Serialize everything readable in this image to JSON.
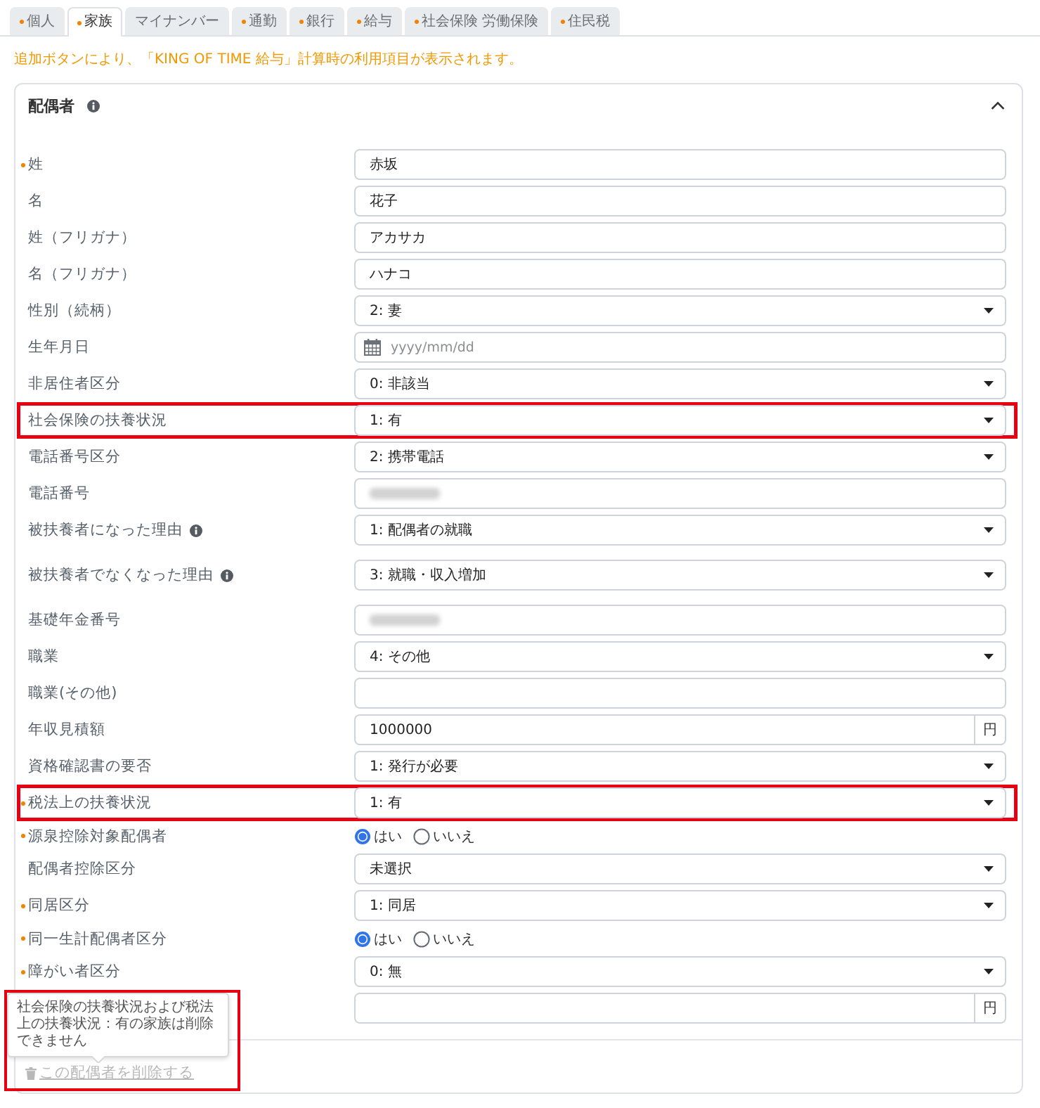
{
  "tabs": [
    {
      "label": "個人",
      "required": true,
      "selected": false
    },
    {
      "label": "家族",
      "required": true,
      "selected": true
    },
    {
      "label": "マイナンバー",
      "required": false,
      "selected": false
    },
    {
      "label": "通勤",
      "required": true,
      "selected": false
    },
    {
      "label": "銀行",
      "required": true,
      "selected": false
    },
    {
      "label": "給与",
      "required": true,
      "selected": false
    },
    {
      "label": "社会保険 労働保険",
      "required": true,
      "selected": false
    },
    {
      "label": "住民税",
      "required": true,
      "selected": false
    }
  ],
  "notice": "追加ボタンにより、「KING OF TIME 給与」計算時の利用項目が表示されます。",
  "card": {
    "title": "配偶者",
    "info": true,
    "expanded": true,
    "fields": [
      {
        "kind": "text",
        "label": "姓",
        "required": true,
        "info": false,
        "highlighted": false,
        "value": "赤坂"
      },
      {
        "kind": "text",
        "label": "名",
        "required": false,
        "info": false,
        "highlighted": false,
        "value": "花子"
      },
      {
        "kind": "text",
        "label": "姓（フリガナ）",
        "required": false,
        "info": false,
        "highlighted": false,
        "value": "アカサカ"
      },
      {
        "kind": "text",
        "label": "名（フリガナ）",
        "required": false,
        "info": false,
        "highlighted": false,
        "value": "ハナコ"
      },
      {
        "kind": "select",
        "label": "性別（続柄）",
        "required": false,
        "info": false,
        "highlighted": false,
        "value": "2: 妻"
      },
      {
        "kind": "date",
        "label": "生年月日",
        "required": false,
        "info": false,
        "highlighted": false,
        "placeholder": "yyyy/mm/dd"
      },
      {
        "kind": "select",
        "label": "非居住者区分",
        "required": false,
        "info": false,
        "highlighted": false,
        "value": "0: 非該当"
      },
      {
        "kind": "select",
        "label": "社会保険の扶養状況",
        "required": false,
        "info": false,
        "highlighted": true,
        "value": "1: 有"
      },
      {
        "kind": "select",
        "label": "電話番号区分",
        "required": false,
        "info": false,
        "highlighted": false,
        "value": "2: 携帯電話"
      },
      {
        "kind": "text",
        "label": "電話番号",
        "required": false,
        "info": false,
        "highlighted": false,
        "blurred": true
      },
      {
        "kind": "select",
        "label": "被扶養者になった理由",
        "required": false,
        "info": true,
        "highlighted": false,
        "value": "1: 配偶者の就職"
      },
      {
        "kind": "select",
        "label": "被扶養者でなくなった理由",
        "required": false,
        "info": true,
        "highlighted": false,
        "value": "3: 就職・収入増加"
      },
      {
        "kind": "text",
        "label": "基礎年金番号",
        "required": false,
        "info": false,
        "highlighted": false,
        "blurred": true
      },
      {
        "kind": "select",
        "label": "職業",
        "required": false,
        "info": false,
        "highlighted": false,
        "value": "4: その他"
      },
      {
        "kind": "text",
        "label": "職業(その他)",
        "required": false,
        "info": false,
        "highlighted": false
      },
      {
        "kind": "currency",
        "label": "年収見積額",
        "required": false,
        "info": false,
        "highlighted": false,
        "value": "1000000",
        "unit": "円"
      },
      {
        "kind": "select",
        "label": "資格確認書の要否",
        "required": false,
        "info": false,
        "highlighted": false,
        "value": "1: 発行が必要"
      },
      {
        "kind": "select",
        "label": "税法上の扶養状況",
        "required": true,
        "info": false,
        "highlighted": true,
        "value": "1: 有"
      },
      {
        "kind": "radio",
        "label": "源泉控除対象配偶者",
        "required": true,
        "info": false,
        "highlighted": false,
        "options": [
          {
            "label": "はい",
            "selected": true
          },
          {
            "label": "いいえ",
            "selected": false
          }
        ]
      },
      {
        "kind": "select",
        "label": "配偶者控除区分",
        "required": false,
        "info": false,
        "highlighted": false,
        "value": "未選択"
      },
      {
        "kind": "select",
        "label": "同居区分",
        "required": true,
        "info": false,
        "highlighted": false,
        "value": "1: 同居"
      },
      {
        "kind": "radio",
        "label": "同一生計配偶者区分",
        "required": true,
        "info": false,
        "highlighted": false,
        "options": [
          {
            "label": "はい",
            "selected": true
          },
          {
            "label": "いいえ",
            "selected": false
          }
        ]
      },
      {
        "kind": "select",
        "label": "障がい者区分",
        "required": true,
        "info": false,
        "highlighted": false,
        "value": "0: 無"
      },
      {
        "kind": "currency",
        "required": false,
        "info": false,
        "highlighted": false,
        "unit": "円"
      }
    ]
  },
  "delete_section": {
    "tooltip": "社会保険の扶養状況および税法上の扶養状況：有の家族は削除できません",
    "link": "この配偶者を削除する",
    "disabled": true,
    "highlighted": true
  }
}
